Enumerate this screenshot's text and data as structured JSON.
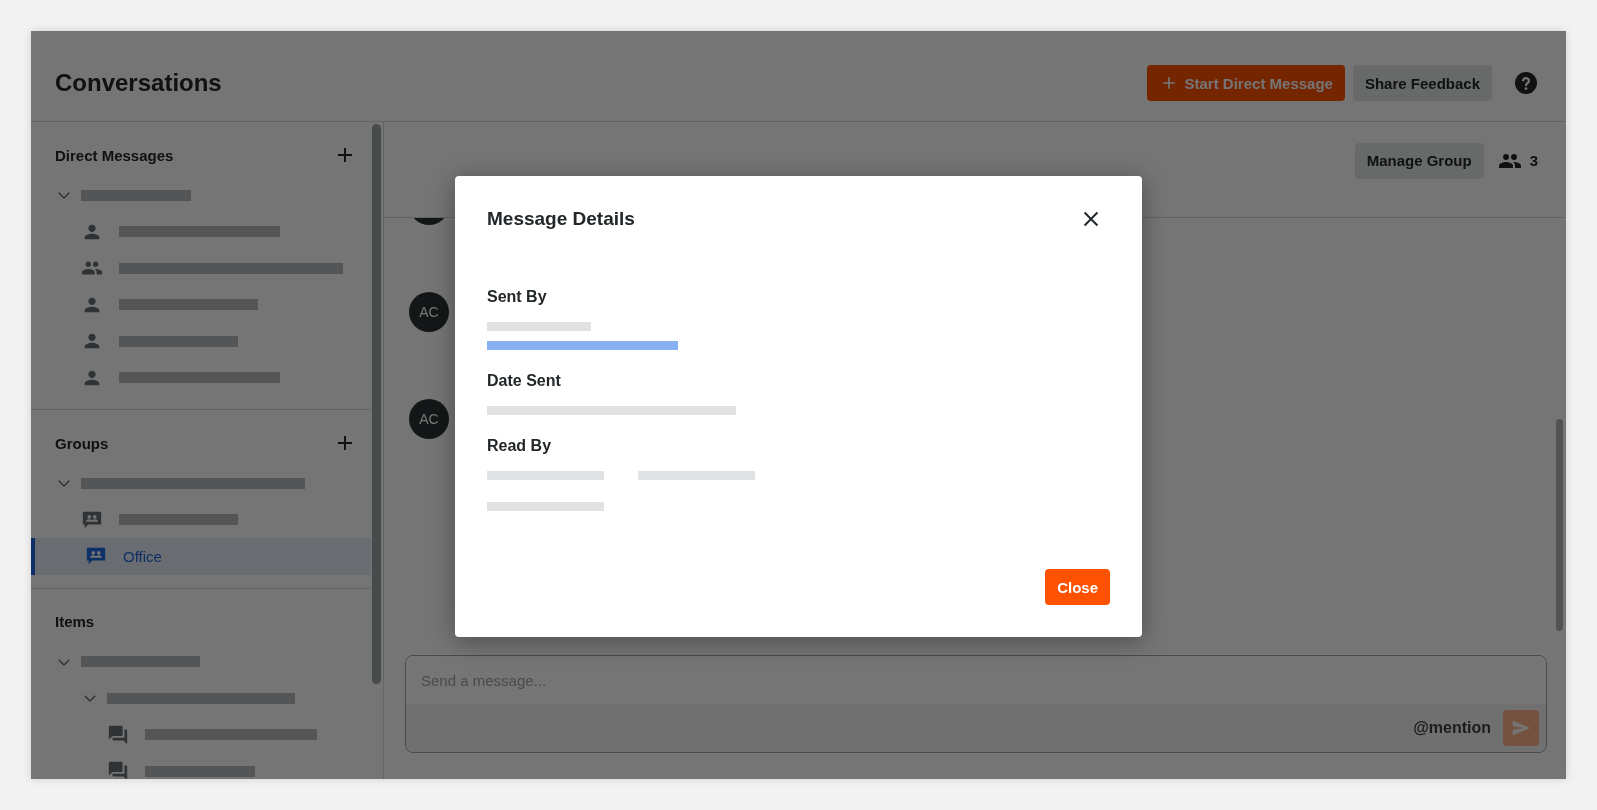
{
  "header": {
    "title": "Conversations",
    "buttons": [
      {
        "label": "Start Direct Message",
        "kind": "primary"
      },
      {
        "label": "Share Feedback",
        "kind": "secondary"
      }
    ]
  },
  "sidebar": {
    "sections": [
      {
        "title": "Direct Messages",
        "can_add": true,
        "tree": [
          {
            "expanded": true,
            "children": [
              {
                "kind": "person",
                "selected": false
              },
              {
                "kind": "people",
                "selected": false
              },
              {
                "kind": "person",
                "selected": false
              },
              {
                "kind": "person",
                "selected": false
              },
              {
                "kind": "person",
                "selected": false
              }
            ]
          }
        ]
      },
      {
        "title": "Groups",
        "can_add": true,
        "tree": [
          {
            "expanded": true,
            "children": [
              {
                "kind": "group-chat",
                "selected": false
              },
              {
                "kind": "group-chat",
                "label": "Office",
                "selected": true
              }
            ]
          }
        ]
      },
      {
        "title": "Items",
        "can_add": false,
        "tree": [
          {
            "expanded": true,
            "children": [
              {
                "expanded": true,
                "children": [
                  {
                    "kind": "thread",
                    "selected": false
                  },
                  {
                    "kind": "thread",
                    "selected": false
                  }
                ]
              }
            ]
          }
        ]
      }
    ]
  },
  "main": {
    "toolbar": {
      "button": "Manage Group",
      "member_count": "3"
    },
    "messages": [
      {
        "initials": "AC"
      },
      {
        "initials": "AC"
      }
    ],
    "composer": {
      "placeholder": "Send a message...",
      "mention": "@mention"
    }
  },
  "modal": {
    "title": "Message Details",
    "fields": [
      {
        "label": "Sent By",
        "kind": "sender"
      },
      {
        "label": "Date Sent",
        "kind": "date"
      },
      {
        "label": "Read By",
        "kind": "readers"
      }
    ],
    "button": "Close"
  }
}
